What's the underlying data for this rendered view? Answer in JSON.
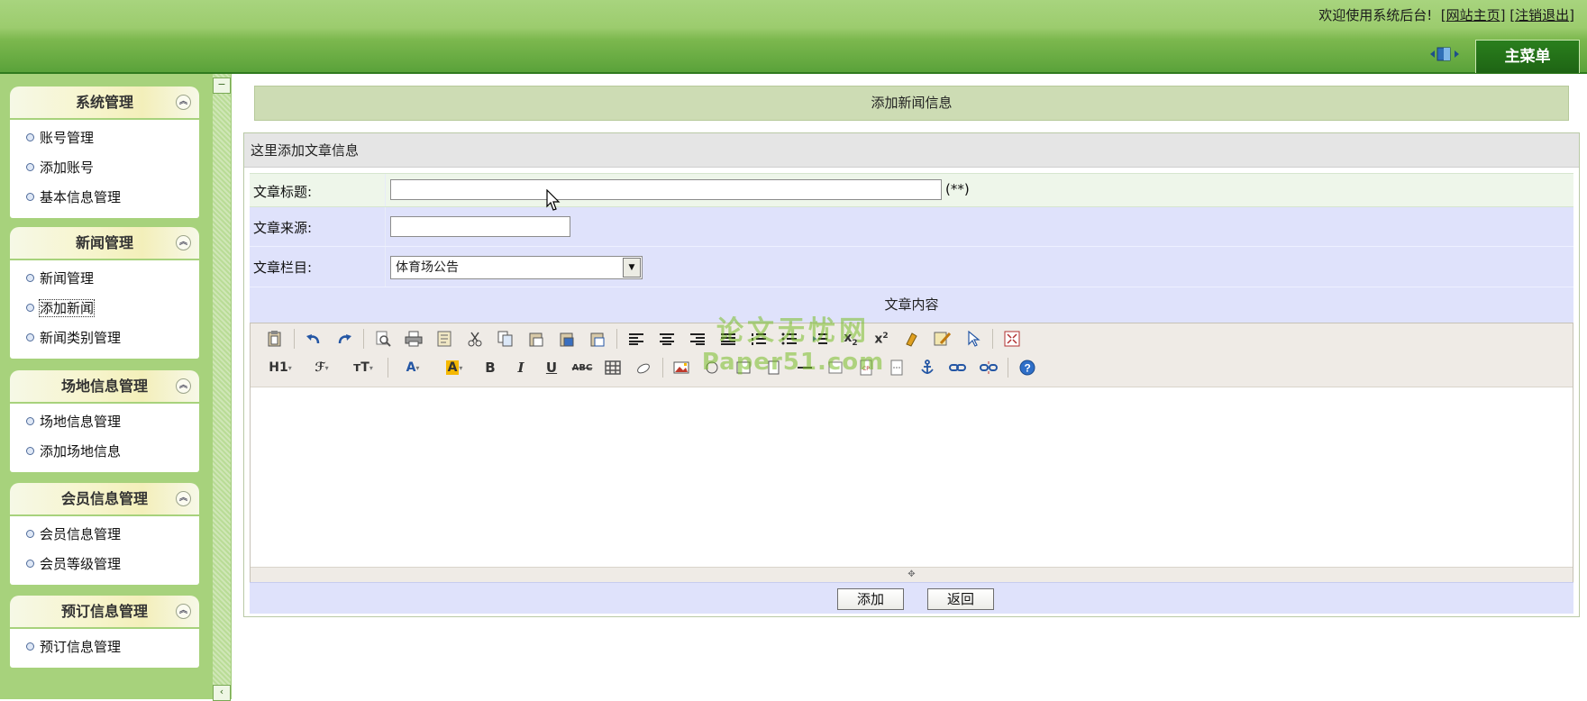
{
  "header": {
    "welcome_text": "欢迎使用系统后台!",
    "home_link": "网站主页",
    "logout_link": "注销退出",
    "main_menu_tab": "主菜单",
    "toggle_icon": "panel-toggle-icon"
  },
  "sidebar": {
    "groups": [
      {
        "title": "系统管理",
        "items": [
          "账号管理",
          "添加账号",
          "基本信息管理"
        ]
      },
      {
        "title": "新闻管理",
        "items": [
          "新闻管理",
          "添加新闻",
          "新闻类别管理"
        ],
        "active_item": "添加新闻"
      },
      {
        "title": "场地信息管理",
        "items": [
          "场地信息管理",
          "添加场地信息"
        ]
      },
      {
        "title": "会员信息管理",
        "items": [
          "会员信息管理",
          "会员等级管理"
        ]
      },
      {
        "title": "预订信息管理",
        "items": [
          "预订信息管理"
        ]
      }
    ]
  },
  "main": {
    "page_title": "添加新闻信息",
    "panel_header": "这里添加文章信息",
    "form": {
      "title_label": "文章标题:",
      "title_value": "",
      "title_note": "(**)",
      "source_label": "文章来源:",
      "source_value": "",
      "category_label": "文章栏目:",
      "category_selected": "体育场公告",
      "content_label": "文章内容"
    },
    "buttons": {
      "add": "添加",
      "back": "返回"
    }
  },
  "editor": {
    "row1_icons": [
      "paste-icon",
      "undo-icon",
      "redo-icon",
      "preview-icon",
      "print-icon",
      "template-icon",
      "cut-icon",
      "copy-icon",
      "paste-text-icon",
      "paste-word-icon",
      "paste-html-icon",
      "align-left-icon",
      "align-center-icon",
      "align-right-icon",
      "align-justify-icon",
      "ordered-list-icon",
      "unordered-list-icon",
      "indent-icon",
      "subscript-icon",
      "superscript-icon",
      "clear-format-icon",
      "spellcheck-icon",
      "select-all-icon",
      "fullscreen-icon"
    ],
    "row2": {
      "heading_label": "H1",
      "font_family_label": "ℱ",
      "font_size_label": "тT",
      "text_color_label": "A",
      "highlight_label": "A",
      "bold_label": "B",
      "italic_label": "I",
      "underline_label": "U",
      "strike_label": "ABC"
    }
  },
  "watermark": {
    "line1": "论文无忧网",
    "line2": "Paper51.com"
  },
  "colors": {
    "header_green": "#7cb84e",
    "tab_green": "#1e6414",
    "sidebar_green": "#a7d27c",
    "form_row_blue": "#dfe2fb"
  }
}
